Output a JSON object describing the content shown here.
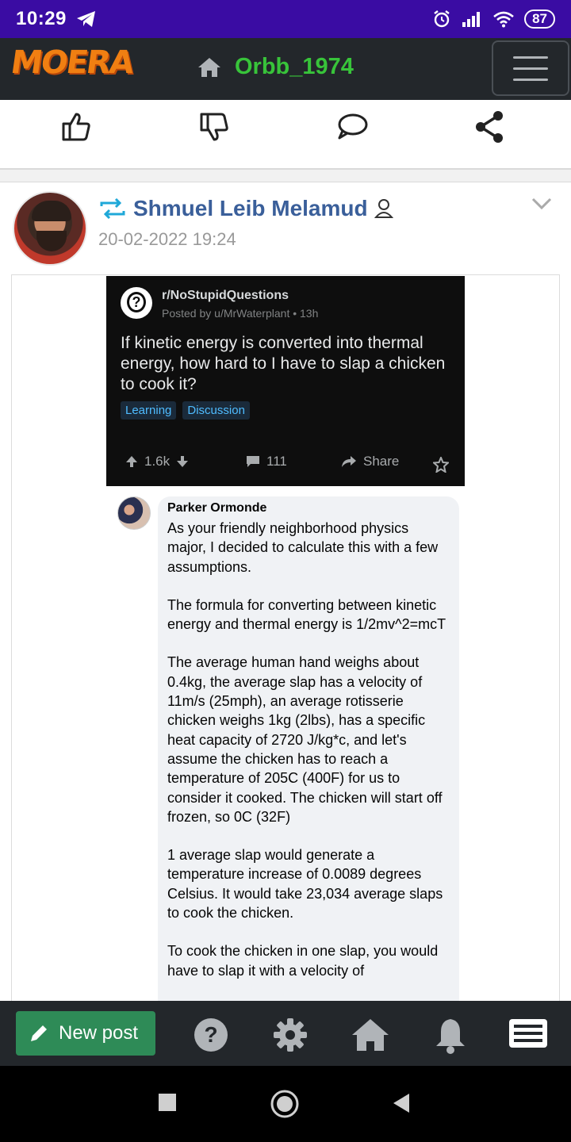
{
  "status_bar": {
    "time": "10:29",
    "battery": "87"
  },
  "app_header": {
    "logo": "MOERA",
    "title": "Orbb_1974"
  },
  "post": {
    "author": "Shmuel Leib Melamud",
    "date": "20-02-2022 19:24"
  },
  "reddit_card": {
    "subreddit": "r/NoStupidQuestions",
    "meta": "Posted by u/MrWaterplant • 13h",
    "title": "If kinetic energy is converted into thermal energy, how hard to I have to slap a chicken to cook it?",
    "tags": [
      "Learning",
      "Discussion"
    ],
    "votes": "1.6k",
    "comments": "111",
    "share": "Share"
  },
  "comment": {
    "author": "Parker Ormonde",
    "paragraphs": [
      "As your friendly neighborhood physics major, I decided to calculate this with a few assumptions.",
      "The formula for converting between kinetic energy and thermal energy is 1/2mv^2=mcT",
      "The average human hand weighs about 0.4kg, the average slap has a velocity of 11m/s (25mph), an average rotisserie chicken weighs 1kg (2lbs), has a specific heat capacity of 2720 J/kg*c, and let's assume the chicken has to reach a temperature of 205C (400F) for us to consider it cooked. The chicken will start off frozen, so 0C (32F)",
      "1 average slap would generate a temperature increase of 0.0089 degrees Celsius. It would take 23,034 average slaps to cook the chicken.",
      "To cook the chicken in one slap, you would have to slap it with a velocity of"
    ]
  },
  "bottom_nav": {
    "new_post": "New post"
  },
  "colors": {
    "status_bar": "#3a0ca3",
    "app_bar": "#23272b",
    "title_green": "#38c43a",
    "author_blue": "#3a5f9a",
    "new_post_green": "#2e8b57"
  }
}
